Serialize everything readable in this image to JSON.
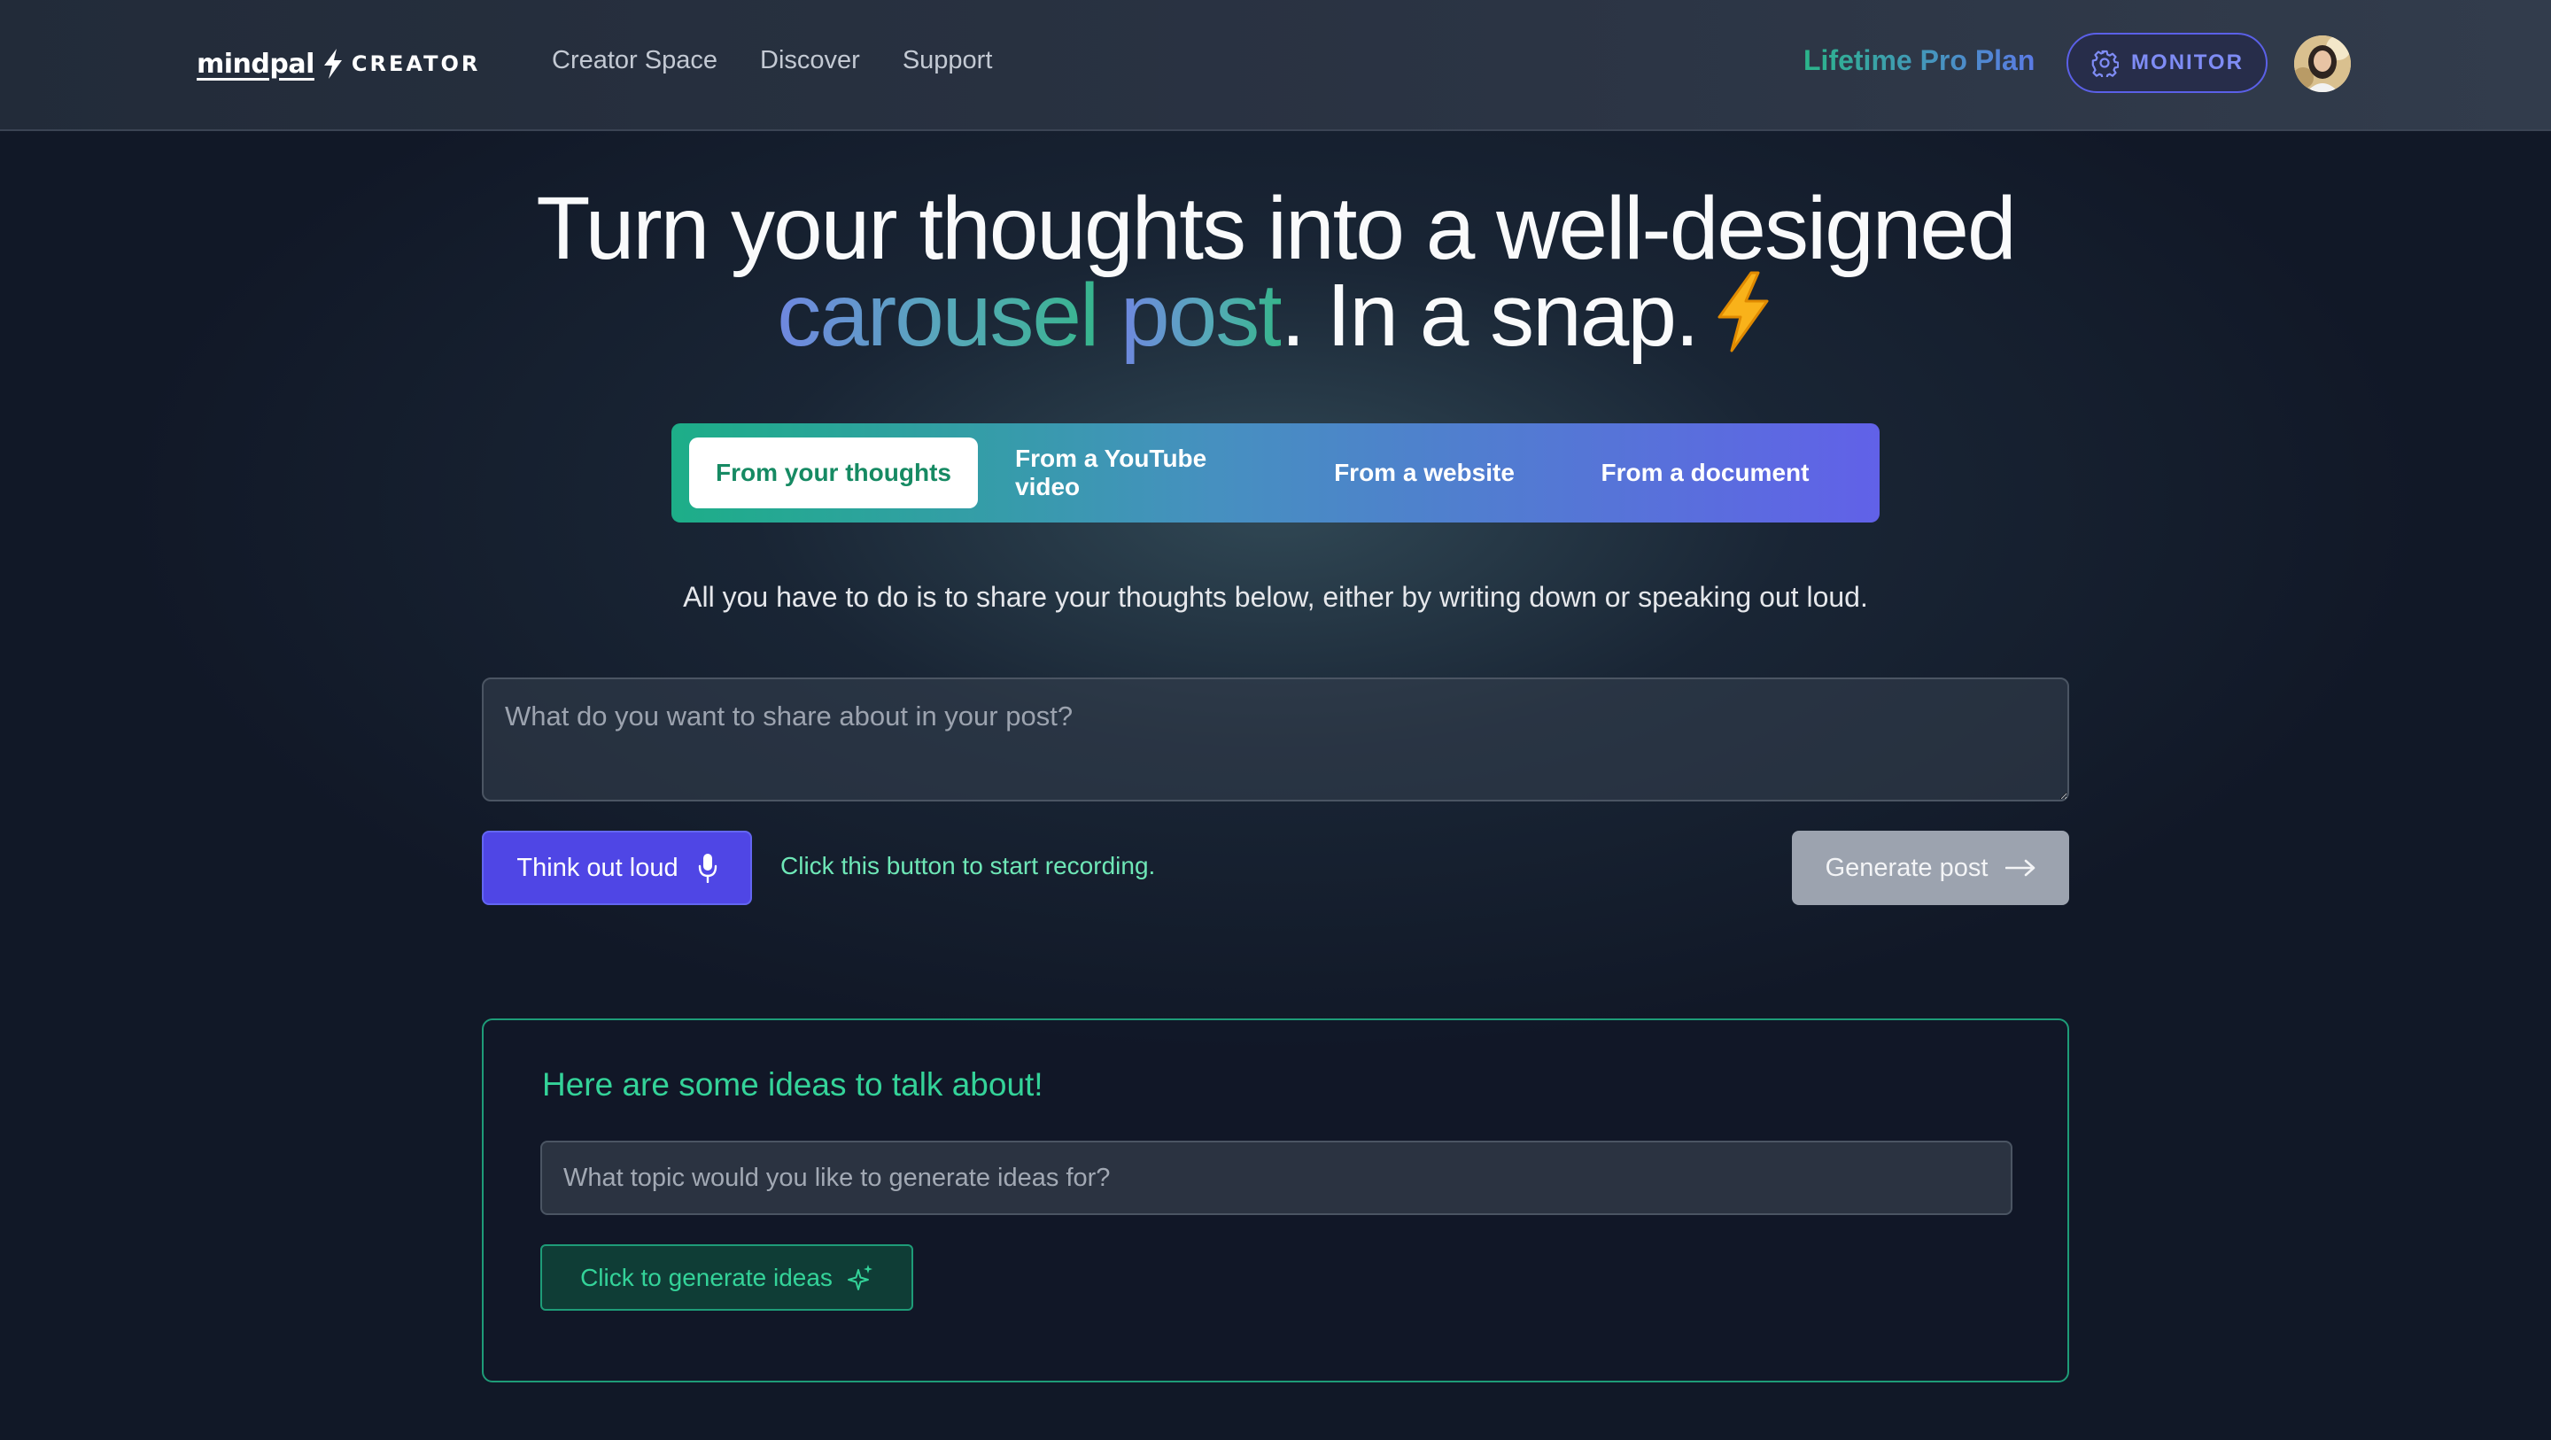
{
  "nav": {
    "logo_word": "mindpal",
    "logo_sub": "CREATOR",
    "links": [
      "Creator Space",
      "Discover",
      "Support"
    ],
    "plan_label": "Lifetime Pro Plan",
    "monitor_label": "MONITOR"
  },
  "hero": {
    "line1": "Turn your thoughts into a well-designed",
    "highlight_1": "carousel",
    "highlight_2": "post",
    "rest": ". In a snap."
  },
  "tabs": [
    "From your thoughts",
    "From a YouTube video",
    "From a website",
    "From a document"
  ],
  "active_tab": "From your thoughts",
  "lead": "All you have to do is to share your thoughts below, either by writing down or speaking out loud.",
  "post_input": {
    "placeholder": "What do you want to share about in your post?",
    "value": ""
  },
  "actions": {
    "think_label": "Think out loud",
    "record_hint": "Click this button to start recording.",
    "generate_label": "Generate post"
  },
  "ideas": {
    "title": "Here are some ideas to talk about!",
    "placeholder": "What topic would you like to generate ideas for?",
    "button_label": "Click to generate ideas"
  },
  "icons": {
    "logo": "lightning-bolt-icon",
    "monitor": "gear-icon",
    "think": "microphone-icon",
    "generate": "arrow-right-icon",
    "ideas": "sparkles-icon",
    "hero": "lightning-emoji"
  },
  "colors": {
    "background": "#111827",
    "accent_green": "#34d399",
    "accent_indigo": "#4f46e5",
    "disabled_button": "#9ca3af"
  }
}
